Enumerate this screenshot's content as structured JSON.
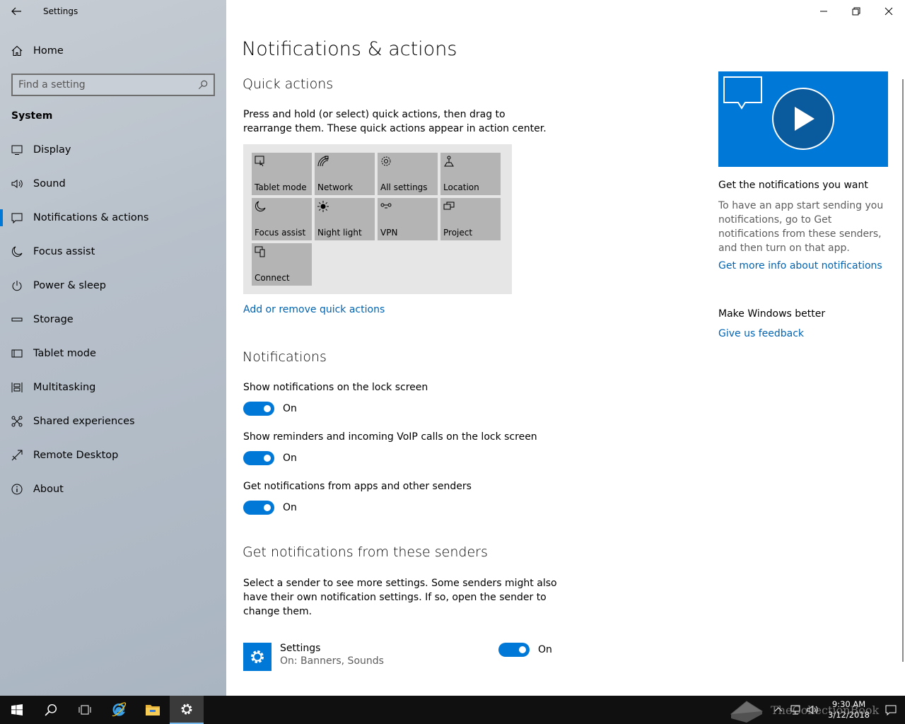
{
  "window": {
    "app_title": "Settings",
    "back_label": "←",
    "minimize_label": "—",
    "close_label": "✕"
  },
  "sidebar": {
    "home": {
      "label": "Home",
      "icon": "home-icon"
    },
    "search": {
      "placeholder": "Find a setting"
    },
    "section_label": "System",
    "items": [
      {
        "label": "Display",
        "icon": "display-icon",
        "active": false
      },
      {
        "label": "Sound",
        "icon": "sound-icon",
        "active": false
      },
      {
        "label": "Notifications & actions",
        "icon": "notifications-icon",
        "active": true
      },
      {
        "label": "Focus assist",
        "icon": "moon-icon",
        "active": false
      },
      {
        "label": "Power & sleep",
        "icon": "power-icon",
        "active": false
      },
      {
        "label": "Storage",
        "icon": "storage-icon",
        "active": false
      },
      {
        "label": "Tablet mode",
        "icon": "tablet-icon",
        "active": false
      },
      {
        "label": "Multitasking",
        "icon": "multitasking-icon",
        "active": false
      },
      {
        "label": "Shared experiences",
        "icon": "shared-icon",
        "active": false
      },
      {
        "label": "Remote Desktop",
        "icon": "remote-desktop-icon",
        "active": false
      },
      {
        "label": "About",
        "icon": "info-icon",
        "active": false
      }
    ]
  },
  "main": {
    "title": "Notifications & actions",
    "quick_actions": {
      "heading": "Quick actions",
      "description": "Press and hold (or select) quick actions, then drag to rearrange them. These quick actions appear in action center.",
      "tiles": [
        {
          "label": "Tablet mode",
          "icon": "tablet-mode-icon"
        },
        {
          "label": "Network",
          "icon": "network-icon"
        },
        {
          "label": "All settings",
          "icon": "gear-icon"
        },
        {
          "label": "Location",
          "icon": "location-icon"
        },
        {
          "label": "Focus assist",
          "icon": "moon-icon"
        },
        {
          "label": "Night light",
          "icon": "sun-icon"
        },
        {
          "label": "VPN",
          "icon": "vpn-icon"
        },
        {
          "label": "Project",
          "icon": "project-icon"
        },
        {
          "label": "Connect",
          "icon": "connect-icon"
        }
      ],
      "link": "Add or remove quick actions"
    },
    "notifications": {
      "heading": "Notifications",
      "settings": [
        {
          "label": "Show notifications on the lock screen",
          "state": "On"
        },
        {
          "label": "Show reminders and incoming VoIP calls on the lock screen",
          "state": "On"
        },
        {
          "label": "Get notifications from apps and other senders",
          "state": "On"
        }
      ]
    },
    "senders": {
      "heading": "Get notifications from these senders",
      "description": "Select a sender to see more settings. Some senders might also have their own notification settings. If so, open the sender to change them.",
      "items": [
        {
          "name": "Settings",
          "subtitle": "On: Banners, Sounds",
          "state": "On",
          "icon": "gear-icon"
        }
      ]
    }
  },
  "side_panel": {
    "video_card": {
      "icon": "play-icon"
    },
    "help_heading": "Get the notifications you want",
    "help_text": "To have an app start sending you notifications, go to Get notifications from these senders, and then turn on that app.",
    "help_link": "Get more info about notifications",
    "feedback_heading": "Make Windows better",
    "feedback_link": "Give us feedback"
  },
  "taskbar": {
    "items": [
      {
        "icon": "windows-start-icon",
        "active": false
      },
      {
        "icon": "search-icon",
        "active": false
      },
      {
        "icon": "task-view-icon",
        "active": false
      },
      {
        "icon": "internet-explorer-icon",
        "active": false
      },
      {
        "icon": "file-explorer-icon",
        "active": false
      },
      {
        "icon": "settings-gear-icon",
        "active": true
      }
    ],
    "clock": {
      "time": "9:30 AM",
      "date": "3/12/2018"
    },
    "watermark": "TheCollectionBook"
  },
  "colors": {
    "accent": "#0078d7",
    "link": "#0063b1",
    "tile": "#b4b4b4",
    "taskbar": "#101010"
  }
}
